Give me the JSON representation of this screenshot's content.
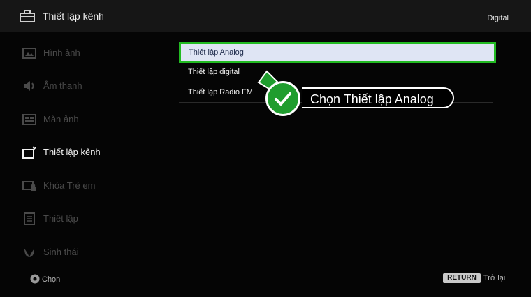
{
  "header": {
    "title": "Thiết lập kênh",
    "mode": "Digital",
    "icon": "toolbox-icon"
  },
  "sidebar": {
    "items": [
      {
        "label": "Hình ảnh",
        "icon": "picture-icon"
      },
      {
        "label": "Âm thanh",
        "icon": "speaker-icon"
      },
      {
        "label": "Màn ảnh",
        "icon": "screen-icon"
      },
      {
        "label": "Thiết lập kênh",
        "icon": "channel-setup-icon",
        "active": true
      },
      {
        "label": "Khóa Trẻ em",
        "icon": "child-lock-icon"
      },
      {
        "label": "Thiết lập",
        "icon": "setup-icon"
      },
      {
        "label": "Sinh thái",
        "icon": "eco-icon"
      }
    ]
  },
  "menu": {
    "items": [
      {
        "label": "Thiết lập Analog",
        "selected": true
      },
      {
        "label": "Thiết lập digital"
      },
      {
        "label": "Thiết lập Radio FM"
      }
    ]
  },
  "callout": {
    "text": "Chọn Thiết lập Analog",
    "icon": "checkmark-icon"
  },
  "footer": {
    "select_label": "Chọn",
    "return_key": "RETURN",
    "return_label": "Trở lại"
  },
  "colors": {
    "highlight_border": "#22bb22",
    "selected_bg": "#dfe5f4",
    "callout_green": "#1f9d2e"
  }
}
